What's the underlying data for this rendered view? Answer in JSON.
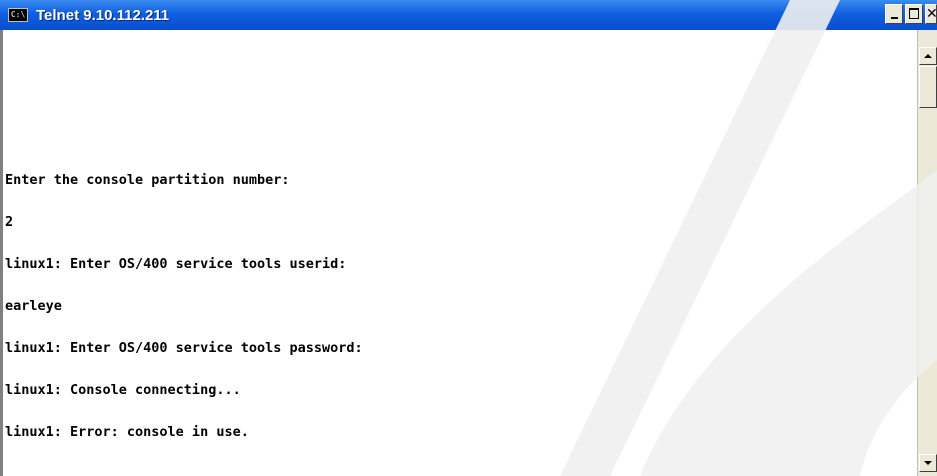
{
  "window": {
    "title": "Telnet 9.10.112.211",
    "icon": "console-icon",
    "icon_text": "C:\\"
  },
  "console": {
    "lines": [
      "Enter the console partition number:",
      "2",
      "linux1: Enter OS/400 service tools userid:",
      "earleye",
      "linux1: Enter OS/400 service tools password:",
      "linux1: Console connecting...",
      "linux1: Error: console in use."
    ]
  },
  "colors": {
    "titlebar": "#0a4fd0",
    "console_background": "#ffffff",
    "console_text": "#000000",
    "watermark": "#f0f0f0"
  }
}
